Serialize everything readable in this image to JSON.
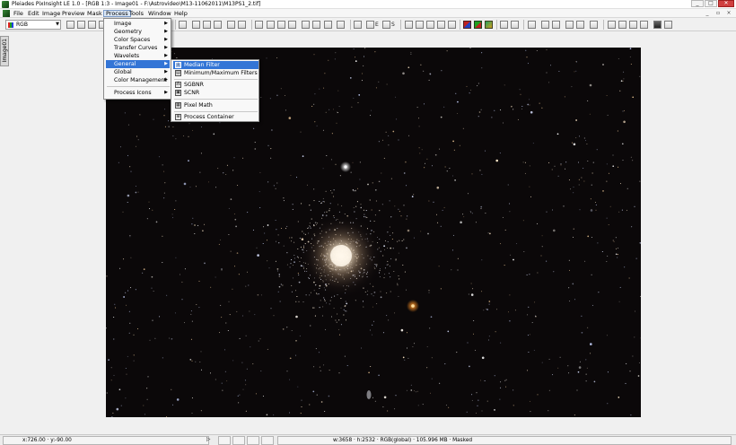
{
  "window": {
    "title": "Pleiades PixInsight LE 1.0 - [RGB 1:3 - Image01 - F:\\Astrovideo\\M13-11062011\\M13PS1_2.tif]",
    "minimize": "_",
    "maximize": "□",
    "close": "✕"
  },
  "menubar": {
    "items": [
      "File",
      "Edit",
      "Image",
      "Preview",
      "Mask",
      "Process",
      "Tools",
      "Window",
      "Help"
    ],
    "active": "Process",
    "mdi": {
      "minimize": "_",
      "restore": "▫",
      "close": "×"
    }
  },
  "toolbar": {
    "channel_select": "RGB",
    "labels": {
      "e": "E",
      "s": "S"
    }
  },
  "side_tab": {
    "label": "Image01"
  },
  "process_menu": {
    "items": [
      {
        "label": "Image",
        "submenu": true
      },
      {
        "label": "Geometry",
        "submenu": true
      },
      {
        "label": "Color Spaces",
        "submenu": true
      },
      {
        "label": "Transfer Curves",
        "submenu": true
      },
      {
        "label": "Wavelets",
        "submenu": true
      },
      {
        "label": "General",
        "submenu": true,
        "highlighted": true
      },
      {
        "label": "Global",
        "submenu": true
      },
      {
        "label": "Color Management",
        "submenu": true
      },
      {
        "label": "Process Icons",
        "submenu": true
      }
    ]
  },
  "general_menu": {
    "items": [
      {
        "label": "Median Filter",
        "icon": "filter-icon",
        "highlighted": true
      },
      {
        "label": "Minimum/Maximum Filters",
        "icon": "minmax-icon"
      },
      {
        "label": "SGBNR",
        "icon": "noise-icon"
      },
      {
        "label": "SCNR",
        "icon": "color-icon"
      },
      {
        "label": "Pixel Math",
        "icon": "math-icon"
      },
      {
        "label": "Process Container",
        "icon": "container-icon"
      }
    ]
  },
  "statusbar": {
    "coords": "x:726.00 · y:-90.00",
    "play_icon": "▷",
    "image_info": "w:3658 · h:2532 · RGB(global) · 105.996 MB · Masked"
  },
  "colors": {
    "menu_highlight": "#3375d6",
    "image_background": "#0a0709"
  }
}
